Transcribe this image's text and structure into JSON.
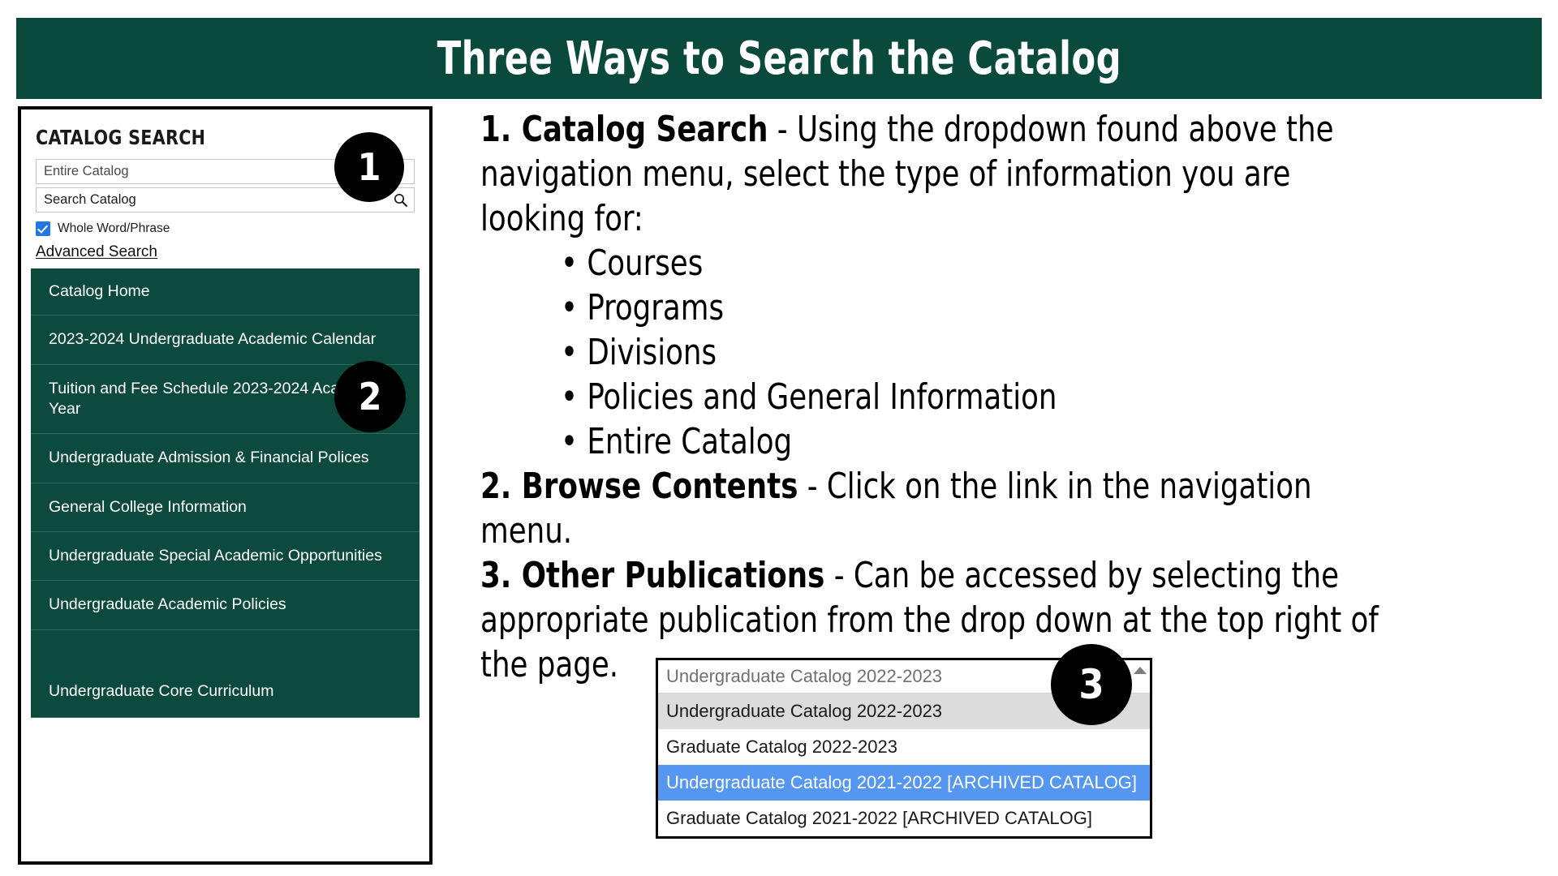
{
  "header": {
    "title": "Three Ways to Search the Catalog",
    "background_color": "#0a4a3c"
  },
  "sidebar": {
    "search_heading": "CATALOG SEARCH",
    "scope_field": {
      "value": "Entire Catalog",
      "icon": "chevron-down-icon"
    },
    "search_field": {
      "placeholder": "Search Catalog",
      "icon": "magnifier-icon"
    },
    "whole_word_checkbox": {
      "label": "Whole Word/Phrase",
      "checked": true,
      "color": "#2176e8"
    },
    "advanced_search_link": "Advanced Search",
    "nav_background_color": "#0b4a3c",
    "nav_items": [
      {
        "label": "Catalog Home"
      },
      {
        "label": "2023-2024 Undergraduate Academic Calendar"
      },
      {
        "label": "Tuition and Fee Schedule 2023-2024 Academic Year"
      },
      {
        "label": "Undergraduate Admission & Financial Polices"
      },
      {
        "label": "General College Information"
      },
      {
        "label": "Undergraduate Special Academic Opportunities"
      },
      {
        "label": "Undergraduate Academic Policies"
      },
      {
        "label": "Undergraduate Core Curriculum"
      }
    ]
  },
  "content": {
    "item1": {
      "number": "1. ",
      "title": "Catalog Search",
      "line1_rest": " - Using the dropdown found above the",
      "line2": "navigation menu, select the type of information you are",
      "line3": "looking for:",
      "bullets": [
        "• Courses",
        "• Programs",
        "• Divisions",
        "• Policies and General Information",
        "• Entire Catalog"
      ]
    },
    "item2": {
      "number": "2. ",
      "title": "Browse Contents",
      "line1_rest": " - Click on the link in the navigation",
      "line2": "menu."
    },
    "item3": {
      "number": "3. ",
      "title": "Other Publications",
      "line1_rest": " - Can be accessed by selecting the",
      "line2": "appropriate publication from the drop down at the top right of",
      "line3": "the page."
    }
  },
  "dropdown": {
    "closed_value": "Undergraduate Catalog 2022-2023",
    "scroll_arrow_icon": "triangle-up-icon",
    "options": [
      {
        "label": "Undergraduate Catalog 2022-2023",
        "state": "hovered"
      },
      {
        "label": "Graduate Catalog 2022-2023",
        "state": "normal"
      },
      {
        "label": "Undergraduate Catalog 2021-2022 [ARCHIVED CATALOG]",
        "state": "selected"
      },
      {
        "label": "Graduate Catalog 2021-2022 [ARCHIVED CATALOG]",
        "state": "normal"
      }
    ],
    "selected_color": "#5596f0",
    "hovered_color": "#dcdcdc"
  },
  "badges": {
    "one": "1",
    "two": "2",
    "three": "3"
  }
}
